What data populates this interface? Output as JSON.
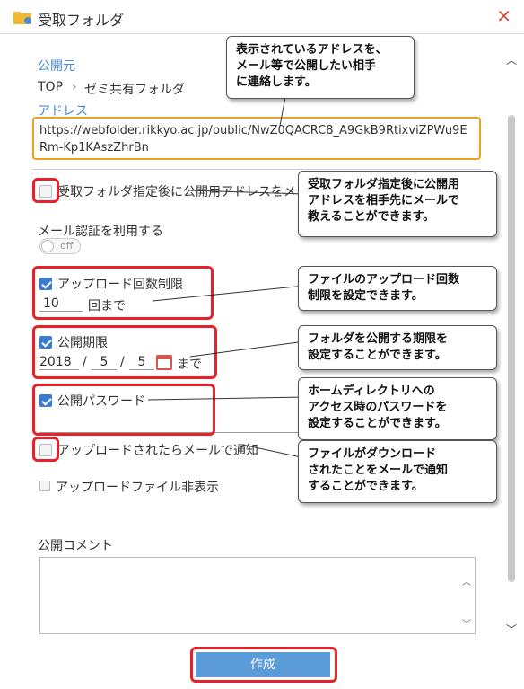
{
  "window": {
    "title": "受取フォルダ",
    "close_icon": "close-icon"
  },
  "publish_source": {
    "label": "公開元",
    "breadcrumb_root": "TOP",
    "breadcrumb_folder": "ゼミ共有フォルダ"
  },
  "address": {
    "label": "アドレス",
    "url": "https://webfolder.rikkyo.ac.jp/public/NwZ0QACRC8_A9GkB9RtixviZPWu9ERm-Kp1KAszZhrBn"
  },
  "options": {
    "notify_address_label": "受取フォルダ指定後に公開用アドレスをメ",
    "mail_auth_label": "メール認証を利用する",
    "toggle_label": "off",
    "upload_limit_label": "アップロード回数制限",
    "upload_limit_value": "10",
    "upload_limit_unit": "回まで",
    "period_label": "公開期限",
    "period_year": "2018",
    "period_month": "5",
    "period_day": "5",
    "period_sep": "/",
    "period_unit": "まで",
    "password_label": "公開パスワード",
    "mail_on_upload_label": "アップロードされたらメールで通知",
    "hide_upload_label": "アップロードファイル非表示"
  },
  "comment": {
    "label": "公開コメント"
  },
  "submit": {
    "label": "作成"
  },
  "callouts": {
    "address_note": [
      "表示されているアドレスを、",
      "メール等で公開したい相手",
      "に連絡します。"
    ],
    "notify_note": [
      "受取フォルダ指定後に公開用",
      "アドレスを相手先にメールで",
      "教えることができます。"
    ],
    "upload_note": [
      "ファイルのアップロード回数",
      "制限を設定できます。"
    ],
    "period_note": [
      "フォルダを公開する期限を",
      "設定することができます。"
    ],
    "password_note": [
      "ホームディレクトリへの",
      "アクセス時のパスワードを",
      "設定することができます。"
    ],
    "download_note": [
      "ファイルがダウンロード",
      "されたことをメールで通知",
      "することができます。"
    ]
  },
  "colors": {
    "accent_blue": "#4a8cd6",
    "highlight_red": "#e8202a",
    "url_border": "#f0a020",
    "button": "#5b9bd8"
  }
}
